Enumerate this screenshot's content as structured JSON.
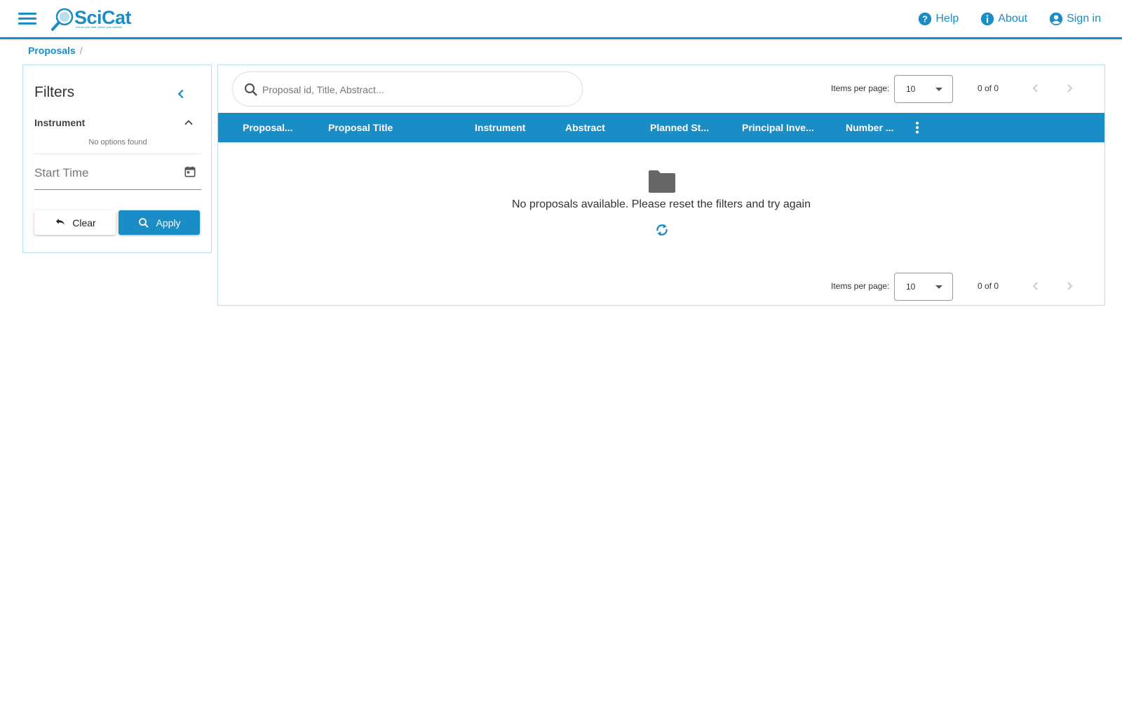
{
  "header": {
    "logo_text": "SciCat",
    "logo_tagline": "unlock your data, power your science",
    "links": [
      {
        "label": "Help",
        "icon": "help-circle-icon"
      },
      {
        "label": "About",
        "icon": "info-circle-icon"
      },
      {
        "label": "Sign in",
        "icon": "account-circle-icon"
      }
    ],
    "accent_color": "#1a8cc6"
  },
  "breadcrumb": {
    "items": [
      "Proposals"
    ],
    "separator": "/"
  },
  "filters": {
    "title": "Filters",
    "instrument_label": "Instrument",
    "instrument_empty": "No options found",
    "start_time_label": "Start Time",
    "clear_label": "Clear",
    "apply_label": "Apply"
  },
  "main": {
    "search_placeholder": "Proposal id, Title, Abstract...",
    "pager_top": {
      "label": "Items per page:",
      "page_size": "10",
      "range": "0 of 0"
    },
    "pager_bottom": {
      "label": "Items per page:",
      "page_size": "10",
      "range": "0 of 0"
    },
    "columns": [
      "Proposal...",
      "Proposal Title",
      "Instrument",
      "Abstract",
      "Planned St...",
      "Principal Inve...",
      "Number ..."
    ],
    "empty_message": "No proposals available. Please reset the filters and try again"
  }
}
